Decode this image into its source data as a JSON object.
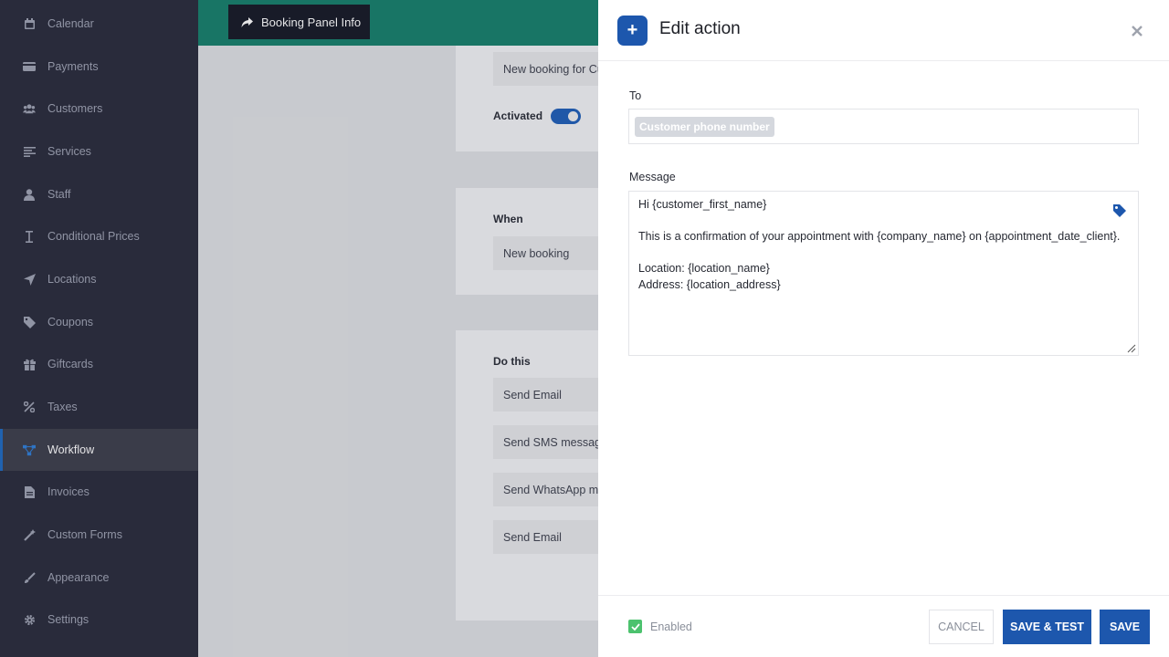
{
  "sidebar": {
    "items": [
      {
        "label": "Calendar",
        "icon": "calendar-icon"
      },
      {
        "label": "Payments",
        "icon": "wallet-icon"
      },
      {
        "label": "Customers",
        "icon": "users-icon"
      },
      {
        "label": "Services",
        "icon": "list-icon"
      },
      {
        "label": "Staff",
        "icon": "user-icon"
      },
      {
        "label": "Conditional Prices",
        "icon": "i-beam-icon"
      },
      {
        "label": "Locations",
        "icon": "location-arrow-icon"
      },
      {
        "label": "Coupons",
        "icon": "tag-icon"
      },
      {
        "label": "Giftcards",
        "icon": "gift-icon"
      },
      {
        "label": "Taxes",
        "icon": "percent-icon"
      },
      {
        "label": "Workflow",
        "icon": "workflow-icon",
        "active": true
      },
      {
        "label": "Invoices",
        "icon": "file-icon"
      },
      {
        "label": "Custom Forms",
        "icon": "magic-wand-icon"
      },
      {
        "label": "Appearance",
        "icon": "brush-icon"
      },
      {
        "label": "Settings",
        "icon": "gear-icon"
      }
    ]
  },
  "topbar": {
    "booking_button": "Booking Panel Info",
    "accent": "#16806b"
  },
  "background": {
    "name_field": "New booking for Cu",
    "activated_label": "Activated",
    "when_label": "When",
    "when_value": "New booking",
    "do_this_label": "Do this",
    "actions": [
      "Send Email",
      "Send SMS message w",
      "Send WhatsApp mes",
      "Send Email"
    ]
  },
  "modal": {
    "title": "Edit action",
    "to_label": "To",
    "to_chip": "Customer phone number",
    "message_label": "Message",
    "message_lines": [
      "Hi {customer_first_name}",
      "",
      "This is a confirmation of your appointment with {company_name} on {appointment_date_client}.",
      "",
      "Location: {location_name}",
      "Address: {location_address}"
    ],
    "enabled_label": "Enabled",
    "cancel_label": "CANCEL",
    "save_test_label": "SAVE & TEST",
    "save_label": "SAVE",
    "primary_color": "#1d57ad"
  }
}
